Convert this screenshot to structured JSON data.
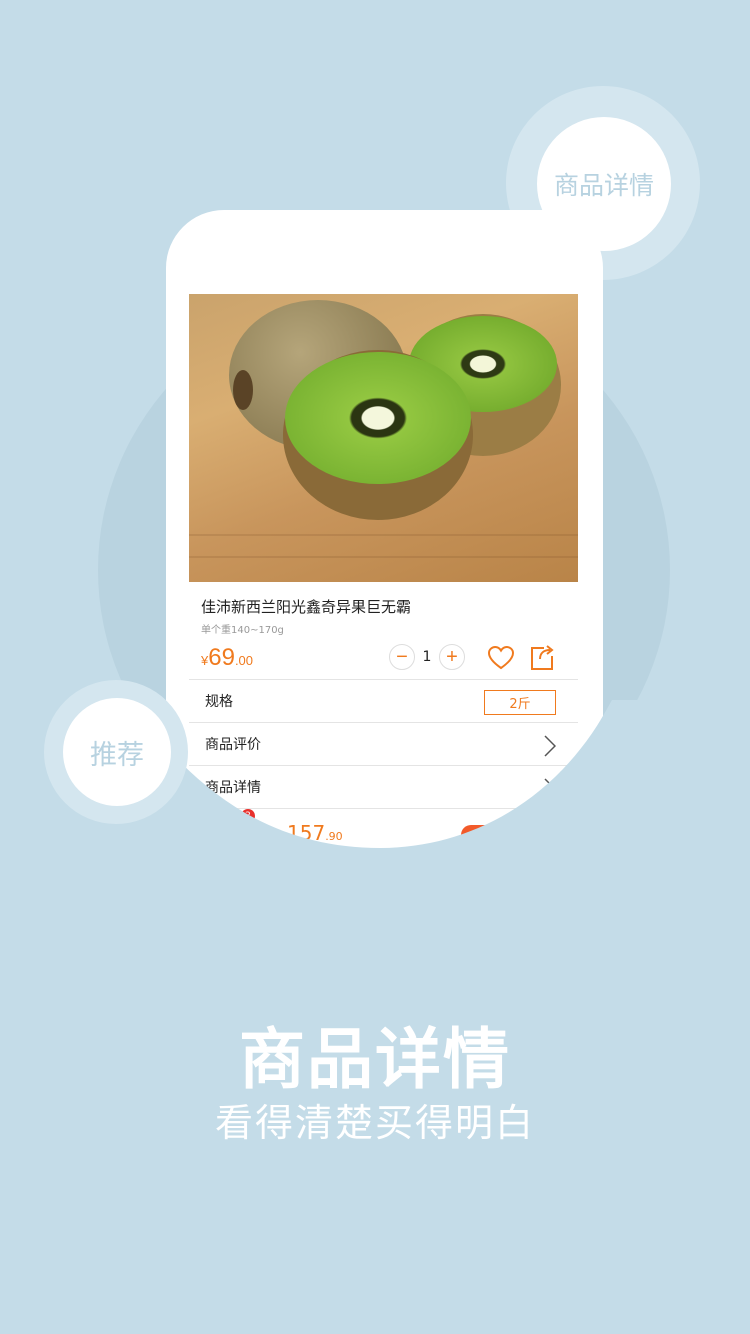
{
  "bubbles": {
    "top_right": "商品详情",
    "left": "推荐"
  },
  "product": {
    "title": "佳沛新西兰阳光鑫奇异果巨无霸",
    "weight": "单个重140~170g",
    "price_symbol": "¥",
    "price_int": "69",
    "price_dec": ".00",
    "quantity": "1",
    "minus": "−",
    "plus": "+"
  },
  "rows": {
    "spec_label": "规格",
    "spec_value": "2斤",
    "reviews_label": "商品评价",
    "details_label": "商品详情"
  },
  "bottom_bar": {
    "cart_count": "2",
    "total_symbol": "¥",
    "total_int": "157",
    "total_dec": ".90"
  },
  "headline": "商品详情",
  "tagline": "看得清楚买得明白",
  "colors": {
    "background": "#c4dce8",
    "accent": "#f07a1e",
    "buy_button": "#f25a2a"
  }
}
